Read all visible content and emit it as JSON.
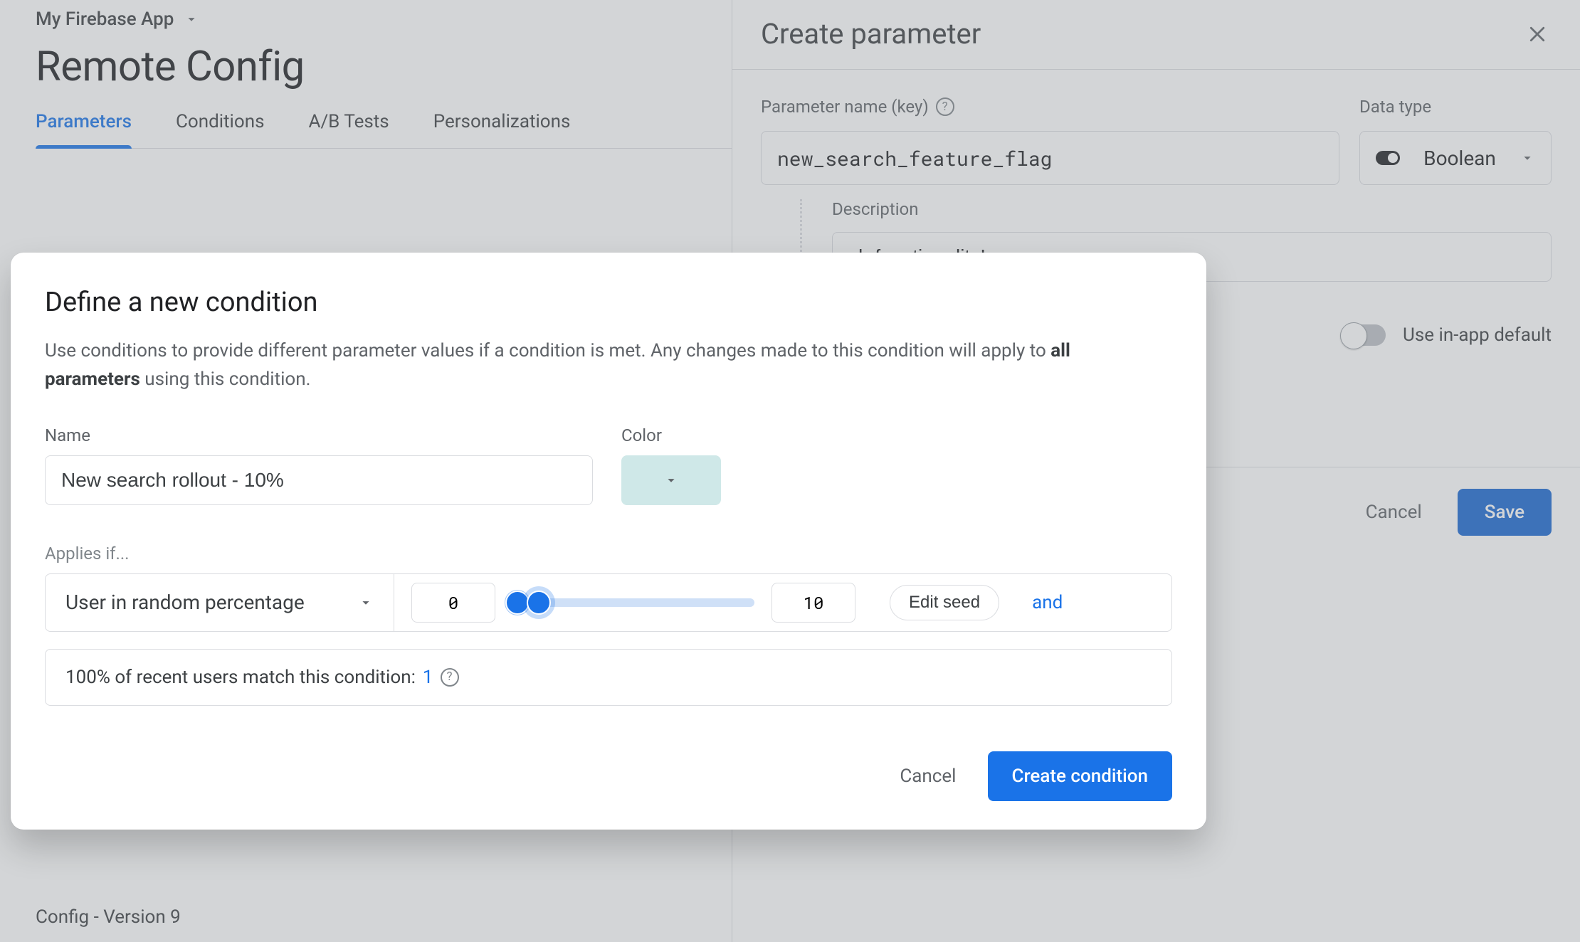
{
  "header": {
    "project_name": "My Firebase App",
    "page_title": "Remote Config",
    "tabs": [
      "Parameters",
      "Conditions",
      "A/B Tests",
      "Personalizations"
    ],
    "active_tab_index": 0,
    "version_text": "Config - Version 9"
  },
  "sheet": {
    "title": "Create parameter",
    "param_label": "Parameter name (key)",
    "param_value": "new_search_feature_flag",
    "type_label": "Data type",
    "type_value": "Boolean",
    "desc_label": "Description",
    "desc_value_visible": "ch functionality!",
    "inapp_label": "Use in-app default",
    "cancel": "Cancel",
    "save": "Save"
  },
  "dialog": {
    "title": "Define a new condition",
    "subtitle_leading": "Use conditions to provide different parameter values if a condition is met. Any changes made to this condition will apply to ",
    "subtitle_bold": "all parameters",
    "subtitle_trailing": " using this condition.",
    "name_label": "Name",
    "name_value": "New search rollout - 10%",
    "color_label": "Color",
    "color_value": "#cfe8e8",
    "applies_label": "Applies if...",
    "rule_type": "User in random percentage",
    "percentile_low": "0",
    "percentile_high": "10",
    "edit_seed": "Edit seed",
    "and": "and",
    "match_text": "100% of recent users match this condition: ",
    "match_count": "1",
    "cancel": "Cancel",
    "create": "Create condition"
  }
}
